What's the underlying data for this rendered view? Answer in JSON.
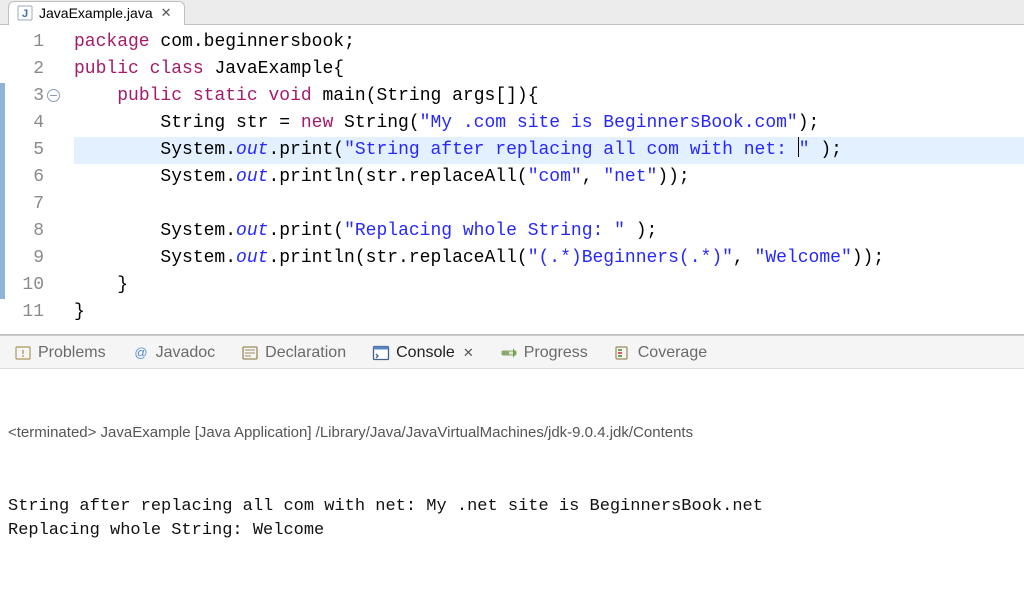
{
  "editor": {
    "tab_title": "JavaExample.java",
    "lines": [
      {
        "n": "1",
        "change": false,
        "fold": false,
        "hl": false,
        "tokens": [
          [
            "kw",
            "package"
          ],
          [
            "",
            " com"
          ],
          [
            "",
            "."
          ],
          [
            "",
            "beginnersbook"
          ],
          [
            "",
            ";"
          ]
        ]
      },
      {
        "n": "2",
        "change": false,
        "fold": false,
        "hl": false,
        "tokens": [
          [
            "kw",
            "public"
          ],
          [
            "",
            " "
          ],
          [
            "kw",
            "class"
          ],
          [
            "",
            " JavaExample{"
          ]
        ]
      },
      {
        "n": "3",
        "change": true,
        "fold": true,
        "hl": false,
        "tokens": [
          [
            "",
            "    "
          ],
          [
            "kw",
            "public"
          ],
          [
            "",
            " "
          ],
          [
            "kw",
            "static"
          ],
          [
            "",
            " "
          ],
          [
            "kw",
            "void"
          ],
          [
            "",
            " main(String args[]){"
          ]
        ]
      },
      {
        "n": "4",
        "change": true,
        "fold": false,
        "hl": false,
        "tokens": [
          [
            "",
            "        String str = "
          ],
          [
            "kw",
            "new"
          ],
          [
            "",
            " String("
          ],
          [
            "str",
            "\"My .com site is BeginnersBook.com\""
          ],
          [
            "",
            ");"
          ]
        ]
      },
      {
        "n": "5",
        "change": true,
        "fold": false,
        "hl": true,
        "cursor_before_last_token": true,
        "tokens": [
          [
            "",
            "        System."
          ],
          [
            "field-italic",
            "out"
          ],
          [
            "",
            ".print("
          ],
          [
            "str",
            "\"String after replacing all com with net: "
          ],
          [
            "cursor",
            ""
          ],
          [
            "str",
            "\""
          ],
          [
            "",
            " );"
          ]
        ]
      },
      {
        "n": "6",
        "change": true,
        "fold": false,
        "hl": false,
        "tokens": [
          [
            "",
            "        System."
          ],
          [
            "field-italic",
            "out"
          ],
          [
            "",
            ".println(str.replaceAll("
          ],
          [
            "str",
            "\"com\""
          ],
          [
            "",
            ", "
          ],
          [
            "str",
            "\"net\""
          ],
          [
            "",
            "));"
          ]
        ]
      },
      {
        "n": "7",
        "change": true,
        "fold": false,
        "hl": false,
        "tokens": [
          [
            "",
            ""
          ]
        ]
      },
      {
        "n": "8",
        "change": true,
        "fold": false,
        "hl": false,
        "tokens": [
          [
            "",
            "        System."
          ],
          [
            "field-italic",
            "out"
          ],
          [
            "",
            ".print("
          ],
          [
            "str",
            "\"Replacing whole String: \""
          ],
          [
            "",
            " );"
          ]
        ]
      },
      {
        "n": "9",
        "change": true,
        "fold": false,
        "hl": false,
        "tokens": [
          [
            "",
            "        System."
          ],
          [
            "field-italic",
            "out"
          ],
          [
            "",
            ".println(str.replaceAll("
          ],
          [
            "str",
            "\"(.*)Beginners(.*)\""
          ],
          [
            "",
            ", "
          ],
          [
            "str",
            "\"Welcome\""
          ],
          [
            "",
            "));"
          ]
        ]
      },
      {
        "n": "10",
        "change": true,
        "fold": false,
        "hl": false,
        "tokens": [
          [
            "",
            "    }"
          ]
        ]
      },
      {
        "n": "11",
        "change": false,
        "fold": false,
        "hl": false,
        "tokens": [
          [
            "",
            "}"
          ]
        ]
      }
    ]
  },
  "views": {
    "tabs": [
      {
        "id": "problems",
        "label": "Problems",
        "active": false
      },
      {
        "id": "javadoc",
        "label": "Javadoc",
        "active": false
      },
      {
        "id": "declaration",
        "label": "Declaration",
        "active": false
      },
      {
        "id": "console",
        "label": "Console",
        "active": true,
        "closable": true
      },
      {
        "id": "progress",
        "label": "Progress",
        "active": false
      },
      {
        "id": "coverage",
        "label": "Coverage",
        "active": false
      }
    ]
  },
  "console": {
    "status": "<terminated> JavaExample [Java Application] /Library/Java/JavaVirtualMachines/jdk-9.0.4.jdk/Contents",
    "lines": [
      "String after replacing all com with net: My .net site is BeginnersBook.net",
      "Replacing whole String: Welcome"
    ]
  }
}
